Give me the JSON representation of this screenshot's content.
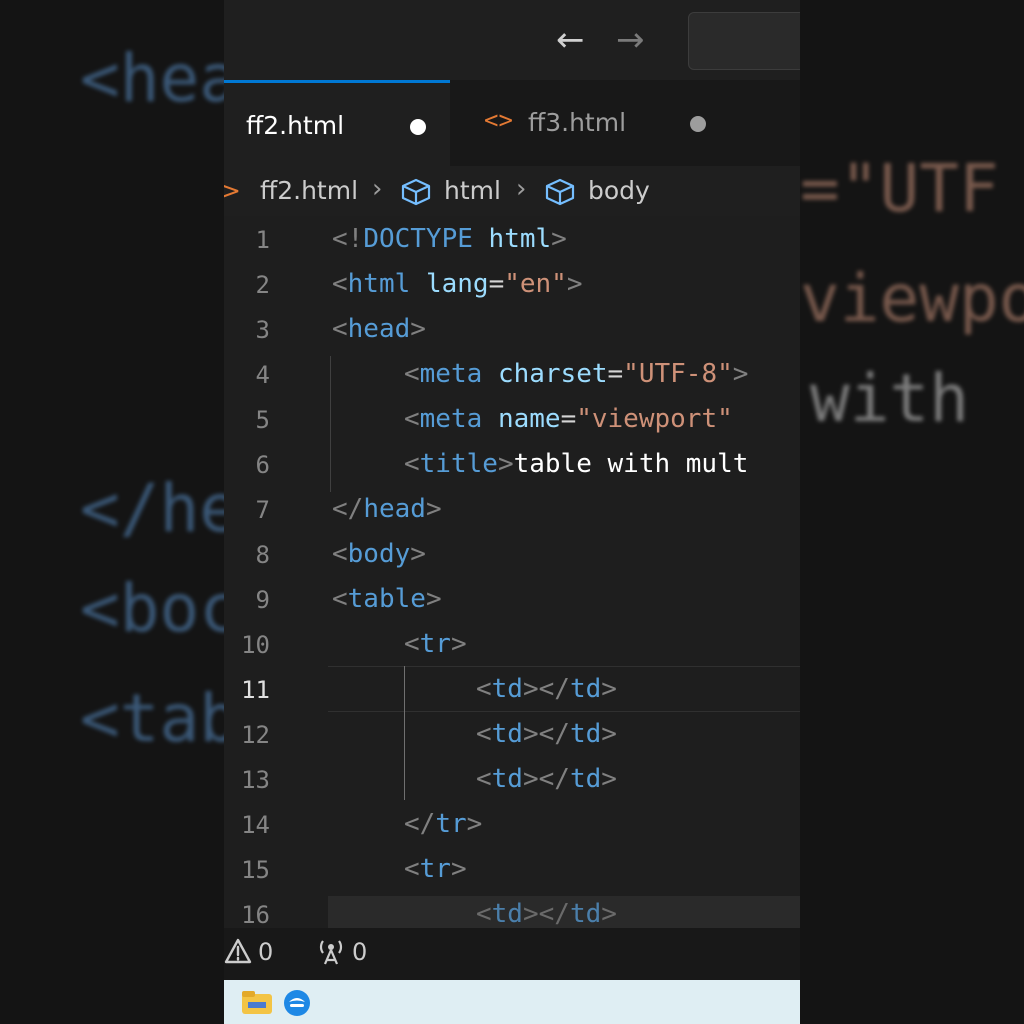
{
  "background": {
    "left_fragments": [
      "<hea",
      "</he",
      "<boc",
      "<tab"
    ],
    "right_fragments": [
      "=\"UTF",
      "viewpo",
      "with "
    ]
  },
  "titlebar": {
    "back_icon": "arrow-left-icon",
    "forward_icon": "arrow-right-icon"
  },
  "tabs": [
    {
      "label": "ff2.html",
      "active": true,
      "modified": true
    },
    {
      "label": "ff3.html",
      "active": false,
      "modified": true,
      "icon": "html-brackets-icon"
    }
  ],
  "breadcrumb": {
    "file": "ff2.html",
    "items": [
      "html",
      "body"
    ]
  },
  "editor": {
    "active_line": 11,
    "line_numbers": [
      "1",
      "2",
      "3",
      "4",
      "5",
      "6",
      "7",
      "8",
      "9",
      "10",
      "11",
      "12",
      "13",
      "14",
      "15",
      "16"
    ],
    "lines": {
      "l1": {
        "a": "<!",
        "b": "DOCTYPE",
        "c": " ",
        "d": "html",
        "e": ">"
      },
      "l2": {
        "a": "<",
        "b": "html",
        "c": " ",
        "d": "lang",
        "e": "=",
        "f": "\"en\"",
        "g": ">"
      },
      "l3": {
        "a": "<",
        "b": "head",
        "c": ">"
      },
      "l4": {
        "a": "<",
        "b": "meta",
        "c": " ",
        "d": "charset",
        "e": "=",
        "f": "\"UTF-8\"",
        "g": ">"
      },
      "l5": {
        "a": "<",
        "b": "meta",
        "c": " ",
        "d": "name",
        "e": "=",
        "f": "\"viewport\""
      },
      "l6": {
        "a": "<",
        "b": "title",
        "c": ">",
        "d": "table with mult"
      },
      "l7": {
        "a": "</",
        "b": "head",
        "c": ">"
      },
      "l8": {
        "a": "<",
        "b": "body",
        "c": ">"
      },
      "l9": {
        "a": "<",
        "b": "table",
        "c": ">"
      },
      "l10": {
        "a": "<",
        "b": "tr",
        "c": ">"
      },
      "l11": {
        "a": "<",
        "b": "td",
        "c": "></",
        "d": "td",
        "e": ">"
      },
      "l12": {
        "a": "<",
        "b": "td",
        "c": "></",
        "d": "td",
        "e": ">"
      },
      "l13": {
        "a": "<",
        "b": "td",
        "c": "></",
        "d": "td",
        "e": ">"
      },
      "l14": {
        "a": "</",
        "b": "tr",
        "c": ">"
      },
      "l15": {
        "a": "<",
        "b": "tr",
        "c": ">"
      },
      "l16": {
        "a": "<",
        "b": "td",
        "c": "></",
        "d": "td",
        "e": ">"
      }
    }
  },
  "statusbar": {
    "warnings_icon": "warning-icon",
    "warnings": "0",
    "ports_icon": "broadcast-icon",
    "ports": "0"
  },
  "taskbar": {
    "apps": [
      "file-explorer-icon",
      "edge-browser-icon"
    ]
  },
  "colors": {
    "accent": "#0078d4",
    "tag": "#569cd6",
    "attribute": "#9cdcfe",
    "string": "#ce9178",
    "bracket": "#808080"
  }
}
